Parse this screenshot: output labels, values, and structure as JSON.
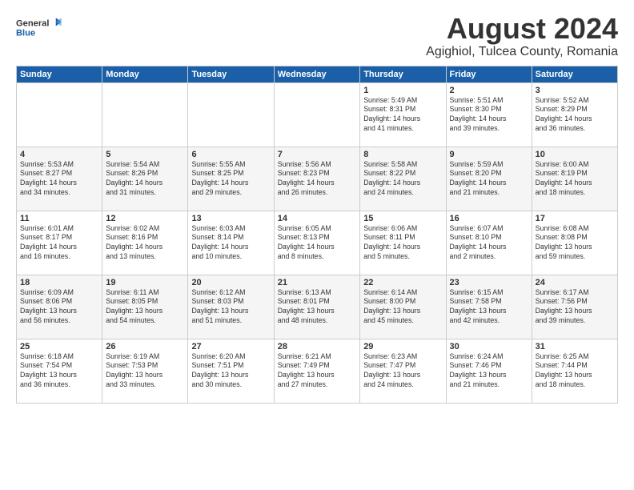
{
  "logo": {
    "general": "General",
    "blue": "Blue"
  },
  "title": "August 2024",
  "subtitle": "Agighiol, Tulcea County, Romania",
  "headers": [
    "Sunday",
    "Monday",
    "Tuesday",
    "Wednesday",
    "Thursday",
    "Friday",
    "Saturday"
  ],
  "weeks": [
    [
      {
        "day": "",
        "info": ""
      },
      {
        "day": "",
        "info": ""
      },
      {
        "day": "",
        "info": ""
      },
      {
        "day": "",
        "info": ""
      },
      {
        "day": "1",
        "info": "Sunrise: 5:49 AM\nSunset: 8:31 PM\nDaylight: 14 hours\nand 41 minutes."
      },
      {
        "day": "2",
        "info": "Sunrise: 5:51 AM\nSunset: 8:30 PM\nDaylight: 14 hours\nand 39 minutes."
      },
      {
        "day": "3",
        "info": "Sunrise: 5:52 AM\nSunset: 8:29 PM\nDaylight: 14 hours\nand 36 minutes."
      }
    ],
    [
      {
        "day": "4",
        "info": "Sunrise: 5:53 AM\nSunset: 8:27 PM\nDaylight: 14 hours\nand 34 minutes."
      },
      {
        "day": "5",
        "info": "Sunrise: 5:54 AM\nSunset: 8:26 PM\nDaylight: 14 hours\nand 31 minutes."
      },
      {
        "day": "6",
        "info": "Sunrise: 5:55 AM\nSunset: 8:25 PM\nDaylight: 14 hours\nand 29 minutes."
      },
      {
        "day": "7",
        "info": "Sunrise: 5:56 AM\nSunset: 8:23 PM\nDaylight: 14 hours\nand 26 minutes."
      },
      {
        "day": "8",
        "info": "Sunrise: 5:58 AM\nSunset: 8:22 PM\nDaylight: 14 hours\nand 24 minutes."
      },
      {
        "day": "9",
        "info": "Sunrise: 5:59 AM\nSunset: 8:20 PM\nDaylight: 14 hours\nand 21 minutes."
      },
      {
        "day": "10",
        "info": "Sunrise: 6:00 AM\nSunset: 8:19 PM\nDaylight: 14 hours\nand 18 minutes."
      }
    ],
    [
      {
        "day": "11",
        "info": "Sunrise: 6:01 AM\nSunset: 8:17 PM\nDaylight: 14 hours\nand 16 minutes."
      },
      {
        "day": "12",
        "info": "Sunrise: 6:02 AM\nSunset: 8:16 PM\nDaylight: 14 hours\nand 13 minutes."
      },
      {
        "day": "13",
        "info": "Sunrise: 6:03 AM\nSunset: 8:14 PM\nDaylight: 14 hours\nand 10 minutes."
      },
      {
        "day": "14",
        "info": "Sunrise: 6:05 AM\nSunset: 8:13 PM\nDaylight: 14 hours\nand 8 minutes."
      },
      {
        "day": "15",
        "info": "Sunrise: 6:06 AM\nSunset: 8:11 PM\nDaylight: 14 hours\nand 5 minutes."
      },
      {
        "day": "16",
        "info": "Sunrise: 6:07 AM\nSunset: 8:10 PM\nDaylight: 14 hours\nand 2 minutes."
      },
      {
        "day": "17",
        "info": "Sunrise: 6:08 AM\nSunset: 8:08 PM\nDaylight: 13 hours\nand 59 minutes."
      }
    ],
    [
      {
        "day": "18",
        "info": "Sunrise: 6:09 AM\nSunset: 8:06 PM\nDaylight: 13 hours\nand 56 minutes."
      },
      {
        "day": "19",
        "info": "Sunrise: 6:11 AM\nSunset: 8:05 PM\nDaylight: 13 hours\nand 54 minutes."
      },
      {
        "day": "20",
        "info": "Sunrise: 6:12 AM\nSunset: 8:03 PM\nDaylight: 13 hours\nand 51 minutes."
      },
      {
        "day": "21",
        "info": "Sunrise: 6:13 AM\nSunset: 8:01 PM\nDaylight: 13 hours\nand 48 minutes."
      },
      {
        "day": "22",
        "info": "Sunrise: 6:14 AM\nSunset: 8:00 PM\nDaylight: 13 hours\nand 45 minutes."
      },
      {
        "day": "23",
        "info": "Sunrise: 6:15 AM\nSunset: 7:58 PM\nDaylight: 13 hours\nand 42 minutes."
      },
      {
        "day": "24",
        "info": "Sunrise: 6:17 AM\nSunset: 7:56 PM\nDaylight: 13 hours\nand 39 minutes."
      }
    ],
    [
      {
        "day": "25",
        "info": "Sunrise: 6:18 AM\nSunset: 7:54 PM\nDaylight: 13 hours\nand 36 minutes."
      },
      {
        "day": "26",
        "info": "Sunrise: 6:19 AM\nSunset: 7:53 PM\nDaylight: 13 hours\nand 33 minutes."
      },
      {
        "day": "27",
        "info": "Sunrise: 6:20 AM\nSunset: 7:51 PM\nDaylight: 13 hours\nand 30 minutes."
      },
      {
        "day": "28",
        "info": "Sunrise: 6:21 AM\nSunset: 7:49 PM\nDaylight: 13 hours\nand 27 minutes."
      },
      {
        "day": "29",
        "info": "Sunrise: 6:23 AM\nSunset: 7:47 PM\nDaylight: 13 hours\nand 24 minutes."
      },
      {
        "day": "30",
        "info": "Sunrise: 6:24 AM\nSunset: 7:46 PM\nDaylight: 13 hours\nand 21 minutes."
      },
      {
        "day": "31",
        "info": "Sunrise: 6:25 AM\nSunset: 7:44 PM\nDaylight: 13 hours\nand 18 minutes."
      }
    ]
  ]
}
